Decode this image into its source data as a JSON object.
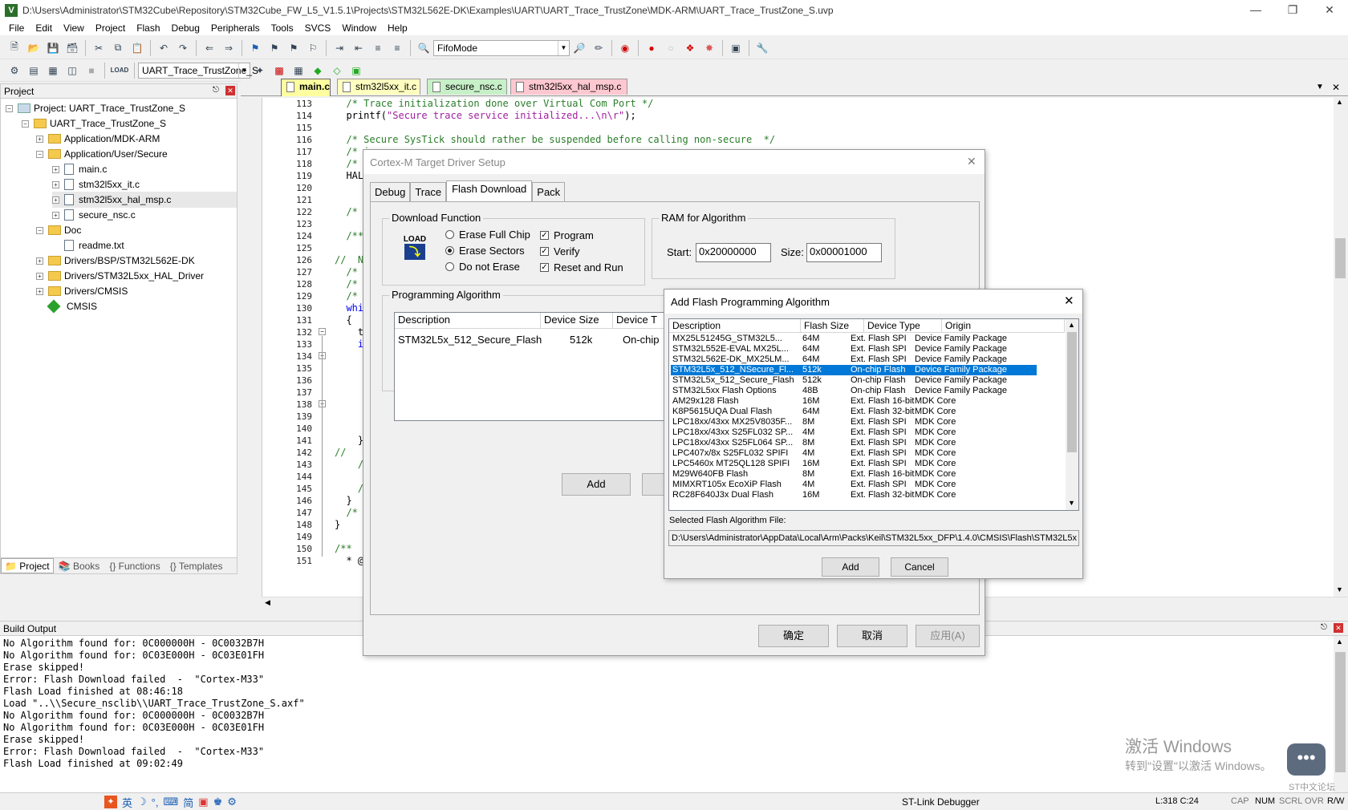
{
  "window": {
    "title": "D:\\Users\\Administrator\\STM32Cube\\Repository\\STM32Cube_FW_L5_V1.5.1\\Projects\\STM32L562E-DK\\Examples\\UART\\UART_Trace_TrustZone\\MDK-ARM\\UART_Trace_TrustZone_S.uvp",
    "app_icon": "V"
  },
  "menu": [
    "File",
    "Edit",
    "View",
    "Project",
    "Flash",
    "Debug",
    "Peripherals",
    "Tools",
    "SVCS",
    "Window",
    "Help"
  ],
  "toolbar": {
    "mode_combo": "FifoMode",
    "target_combo": "UART_Trace_TrustZone_S",
    "load_label": "LOAD"
  },
  "project_panel": {
    "title": "Project",
    "tree": [
      {
        "label": "Project: UART_Trace_TrustZone_S",
        "level": 0,
        "type": "project"
      },
      {
        "label": "UART_Trace_TrustZone_S",
        "level": 1,
        "type": "target"
      },
      {
        "label": "Application/MDK-ARM",
        "level": 2,
        "type": "folder"
      },
      {
        "label": "Application/User/Secure",
        "level": 2,
        "type": "folder"
      },
      {
        "label": "main.c",
        "level": 3,
        "type": "file"
      },
      {
        "label": "stm32l5xx_it.c",
        "level": 3,
        "type": "file"
      },
      {
        "label": "stm32l5xx_hal_msp.c",
        "level": 3,
        "type": "file"
      },
      {
        "label": "secure_nsc.c",
        "level": 3,
        "type": "file"
      },
      {
        "label": "Doc",
        "level": 2,
        "type": "folder"
      },
      {
        "label": "readme.txt",
        "level": 3,
        "type": "file"
      },
      {
        "label": "Drivers/BSP/STM32L562E-DK",
        "level": 2,
        "type": "folder"
      },
      {
        "label": "Drivers/STM32L5xx_HAL_Driver",
        "level": 2,
        "type": "folder"
      },
      {
        "label": "Drivers/CMSIS",
        "level": 2,
        "type": "folder"
      },
      {
        "label": "CMSIS",
        "level": 2,
        "type": "component"
      }
    ],
    "tabs": [
      "Project",
      "Books",
      "Functions",
      "Templates"
    ]
  },
  "editor": {
    "tabs": [
      {
        "label": "main.c",
        "color": "#ffffa0",
        "active": true
      },
      {
        "label": "stm32l5xx_it.c",
        "color": "#ffffc0"
      },
      {
        "label": "secure_nsc.c",
        "color": "#c8f0c8"
      },
      {
        "label": "stm32l5xx_hal_msp.c",
        "color": "#ffc8d0"
      }
    ],
    "lines": [
      {
        "n": "113",
        "code": "  /* Trace initialization done over Virtual Com Port */"
      },
      {
        "n": "114",
        "code": "  printf(\"Secure trace service initialized...\\n\\r\");"
      },
      {
        "n": "115",
        "code": ""
      },
      {
        "n": "116",
        "code": "  /* Secure SysTick should rather be suspended before calling non-secure  */"
      },
      {
        "n": "117",
        "code": "  /* i"
      },
      {
        "n": "118",
        "code": "  /* Th"
      },
      {
        "n": "119",
        "code": "  HAL_S"
      },
      {
        "n": "120",
        "code": ""
      },
      {
        "n": "121",
        "code": ""
      },
      {
        "n": "122",
        "code": "  /* U"
      },
      {
        "n": "123",
        "code": ""
      },
      {
        "n": "124",
        "code": "  /***"
      },
      {
        "n": "125",
        "code": ""
      },
      {
        "n": "126",
        "code": "//  Nor"
      },
      {
        "n": "127",
        "code": "  /* No"
      },
      {
        "n": "128",
        "code": "  /* In"
      },
      {
        "n": "129",
        "code": "  /* U"
      },
      {
        "n": "130",
        "code": "  while"
      },
      {
        "n": "131",
        "code": "  {"
      },
      {
        "n": "132",
        "code": "    tir"
      },
      {
        "n": "133",
        "code": "    if"
      },
      {
        "n": "134",
        "code": "      {"
      },
      {
        "n": "135",
        "code": "      r"
      },
      {
        "n": "136",
        "code": "      i"
      },
      {
        "n": "137",
        "code": ""
      },
      {
        "n": "138",
        "code": ""
      },
      {
        "n": "139",
        "code": ""
      },
      {
        "n": "140",
        "code": "      }"
      },
      {
        "n": "141",
        "code": "    }"
      },
      {
        "n": "142",
        "code": "//    H"
      },
      {
        "n": "143",
        "code": "    /*"
      },
      {
        "n": "144",
        "code": ""
      },
      {
        "n": "145",
        "code": "    /*"
      },
      {
        "n": "146",
        "code": "  }"
      },
      {
        "n": "147",
        "code": "  /* U"
      },
      {
        "n": "148",
        "code": "}"
      },
      {
        "n": "149",
        "code": ""
      },
      {
        "n": "150",
        "code": "/**"
      },
      {
        "n": "151",
        "code": "  * @b"
      }
    ]
  },
  "target_dialog": {
    "title": "Cortex-M Target Driver Setup",
    "tabs": [
      "Debug",
      "Trace",
      "Flash Download",
      "Pack"
    ],
    "download_function": {
      "label": "Download Function",
      "load_icon": "LOAD",
      "options": [
        "Erase Full Chip",
        "Erase Sectors",
        "Do not Erase"
      ],
      "selected": "Erase Sectors",
      "checks": [
        {
          "label": "Program",
          "checked": true
        },
        {
          "label": "Verify",
          "checked": true
        },
        {
          "label": "Reset and Run",
          "checked": true
        }
      ]
    },
    "ram": {
      "label": "RAM for Algorithm",
      "start_label": "Start:",
      "start": "0x20000000",
      "size_label": "Size:",
      "size": "0x00001000"
    },
    "prog_algo": {
      "label": "Programming Algorithm",
      "columns": [
        "Description",
        "Device Size",
        "Device T"
      ],
      "rows": [
        [
          "STM32L5x_512_Secure_Flash",
          "512k",
          "On-chip"
        ]
      ]
    },
    "add_button": "Add",
    "ok": "确定",
    "cancel": "取消",
    "apply": "应用(A)"
  },
  "add_flash_dialog": {
    "title": "Add Flash Programming Algorithm",
    "columns": [
      "Description",
      "Flash Size",
      "Device Type",
      "Origin"
    ],
    "rows": [
      [
        "MX25L51245G_STM32L5...",
        "64M",
        "Ext. Flash SPI",
        "Device Family Package"
      ],
      [
        "STM32L552E-EVAL MX25L...",
        "64M",
        "Ext. Flash SPI",
        "Device Family Package"
      ],
      [
        "STM32L562E-DK_MX25LM...",
        "64M",
        "Ext. Flash SPI",
        "Device Family Package"
      ],
      [
        "STM32L5x_512_NSecure_Fl...",
        "512k",
        "On-chip Flash",
        "Device Family Package"
      ],
      [
        "STM32L5x_512_Secure_Flash",
        "512k",
        "On-chip Flash",
        "Device Family Package"
      ],
      [
        "STM32L5xx Flash Options",
        "48B",
        "On-chip Flash",
        "Device Family Package"
      ],
      [
        "AM29x128 Flash",
        "16M",
        "Ext. Flash 16-bit",
        "MDK Core"
      ],
      [
        "K8P5615UQA Dual Flash",
        "64M",
        "Ext. Flash 32-bit",
        "MDK Core"
      ],
      [
        "LPC18xx/43xx MX25V8035F...",
        "8M",
        "Ext. Flash SPI",
        "MDK Core"
      ],
      [
        "LPC18xx/43xx S25FL032 SP...",
        "4M",
        "Ext. Flash SPI",
        "MDK Core"
      ],
      [
        "LPC18xx/43xx S25FL064 SP...",
        "8M",
        "Ext. Flash SPI",
        "MDK Core"
      ],
      [
        "LPC407x/8x S25FL032 SPIFI",
        "4M",
        "Ext. Flash SPI",
        "MDK Core"
      ],
      [
        "LPC5460x MT25QL128 SPIFI",
        "16M",
        "Ext. Flash SPI",
        "MDK Core"
      ],
      [
        "M29W640FB Flash",
        "8M",
        "Ext. Flash 16-bit",
        "MDK Core"
      ],
      [
        "MIMXRT105x EcoXiP Flash",
        "4M",
        "Ext. Flash SPI",
        "MDK Core"
      ],
      [
        "RC28F640J3x Dual Flash",
        "16M",
        "Ext. Flash 32-bit",
        "MDK Core"
      ]
    ],
    "selected_index": 3,
    "file_label": "Selected Flash Algorithm File:",
    "file_path": "D:\\Users\\Administrator\\AppData\\Local\\Arm\\Packs\\Keil\\STM32L5xx_DFP\\1.4.0\\CMSIS\\Flash\\STM32L5x",
    "add": "Add",
    "cancel": "Cancel"
  },
  "build_output": {
    "title": "Build Output",
    "lines": [
      "No Algorithm found for: 0C000000H - 0C0032B7H",
      "No Algorithm found for: 0C03E000H - 0C03E01FH",
      "Erase skipped!",
      "Error: Flash Download failed  -  \"Cortex-M33\"",
      "Flash Load finished at 08:46:18",
      "Load \"..\\\\Secure_nsclib\\\\UART_Trace_TrustZone_S.axf\"",
      "No Algorithm found for: 0C000000H - 0C0032B7H",
      "No Algorithm found for: 0C03E000H - 0C03E01FH",
      "Erase skipped!",
      "Error: Flash Download failed  -  \"Cortex-M33\"",
      "Flash Load finished at 09:02:49"
    ]
  },
  "watermark": {
    "line1": "激活 Windows",
    "line2": "转到\"设置\"以激活 Windows。",
    "corner": "ST中文论坛"
  },
  "ime": {
    "lang": "英",
    "simplified": "简"
  },
  "status": {
    "debugger": "ST-Link Debugger",
    "position": "L:318 C:24",
    "caps": "CAP",
    "num": "NUM",
    "scrl": "SCRL",
    "ovr": "OVR",
    "rw": "R/W"
  }
}
